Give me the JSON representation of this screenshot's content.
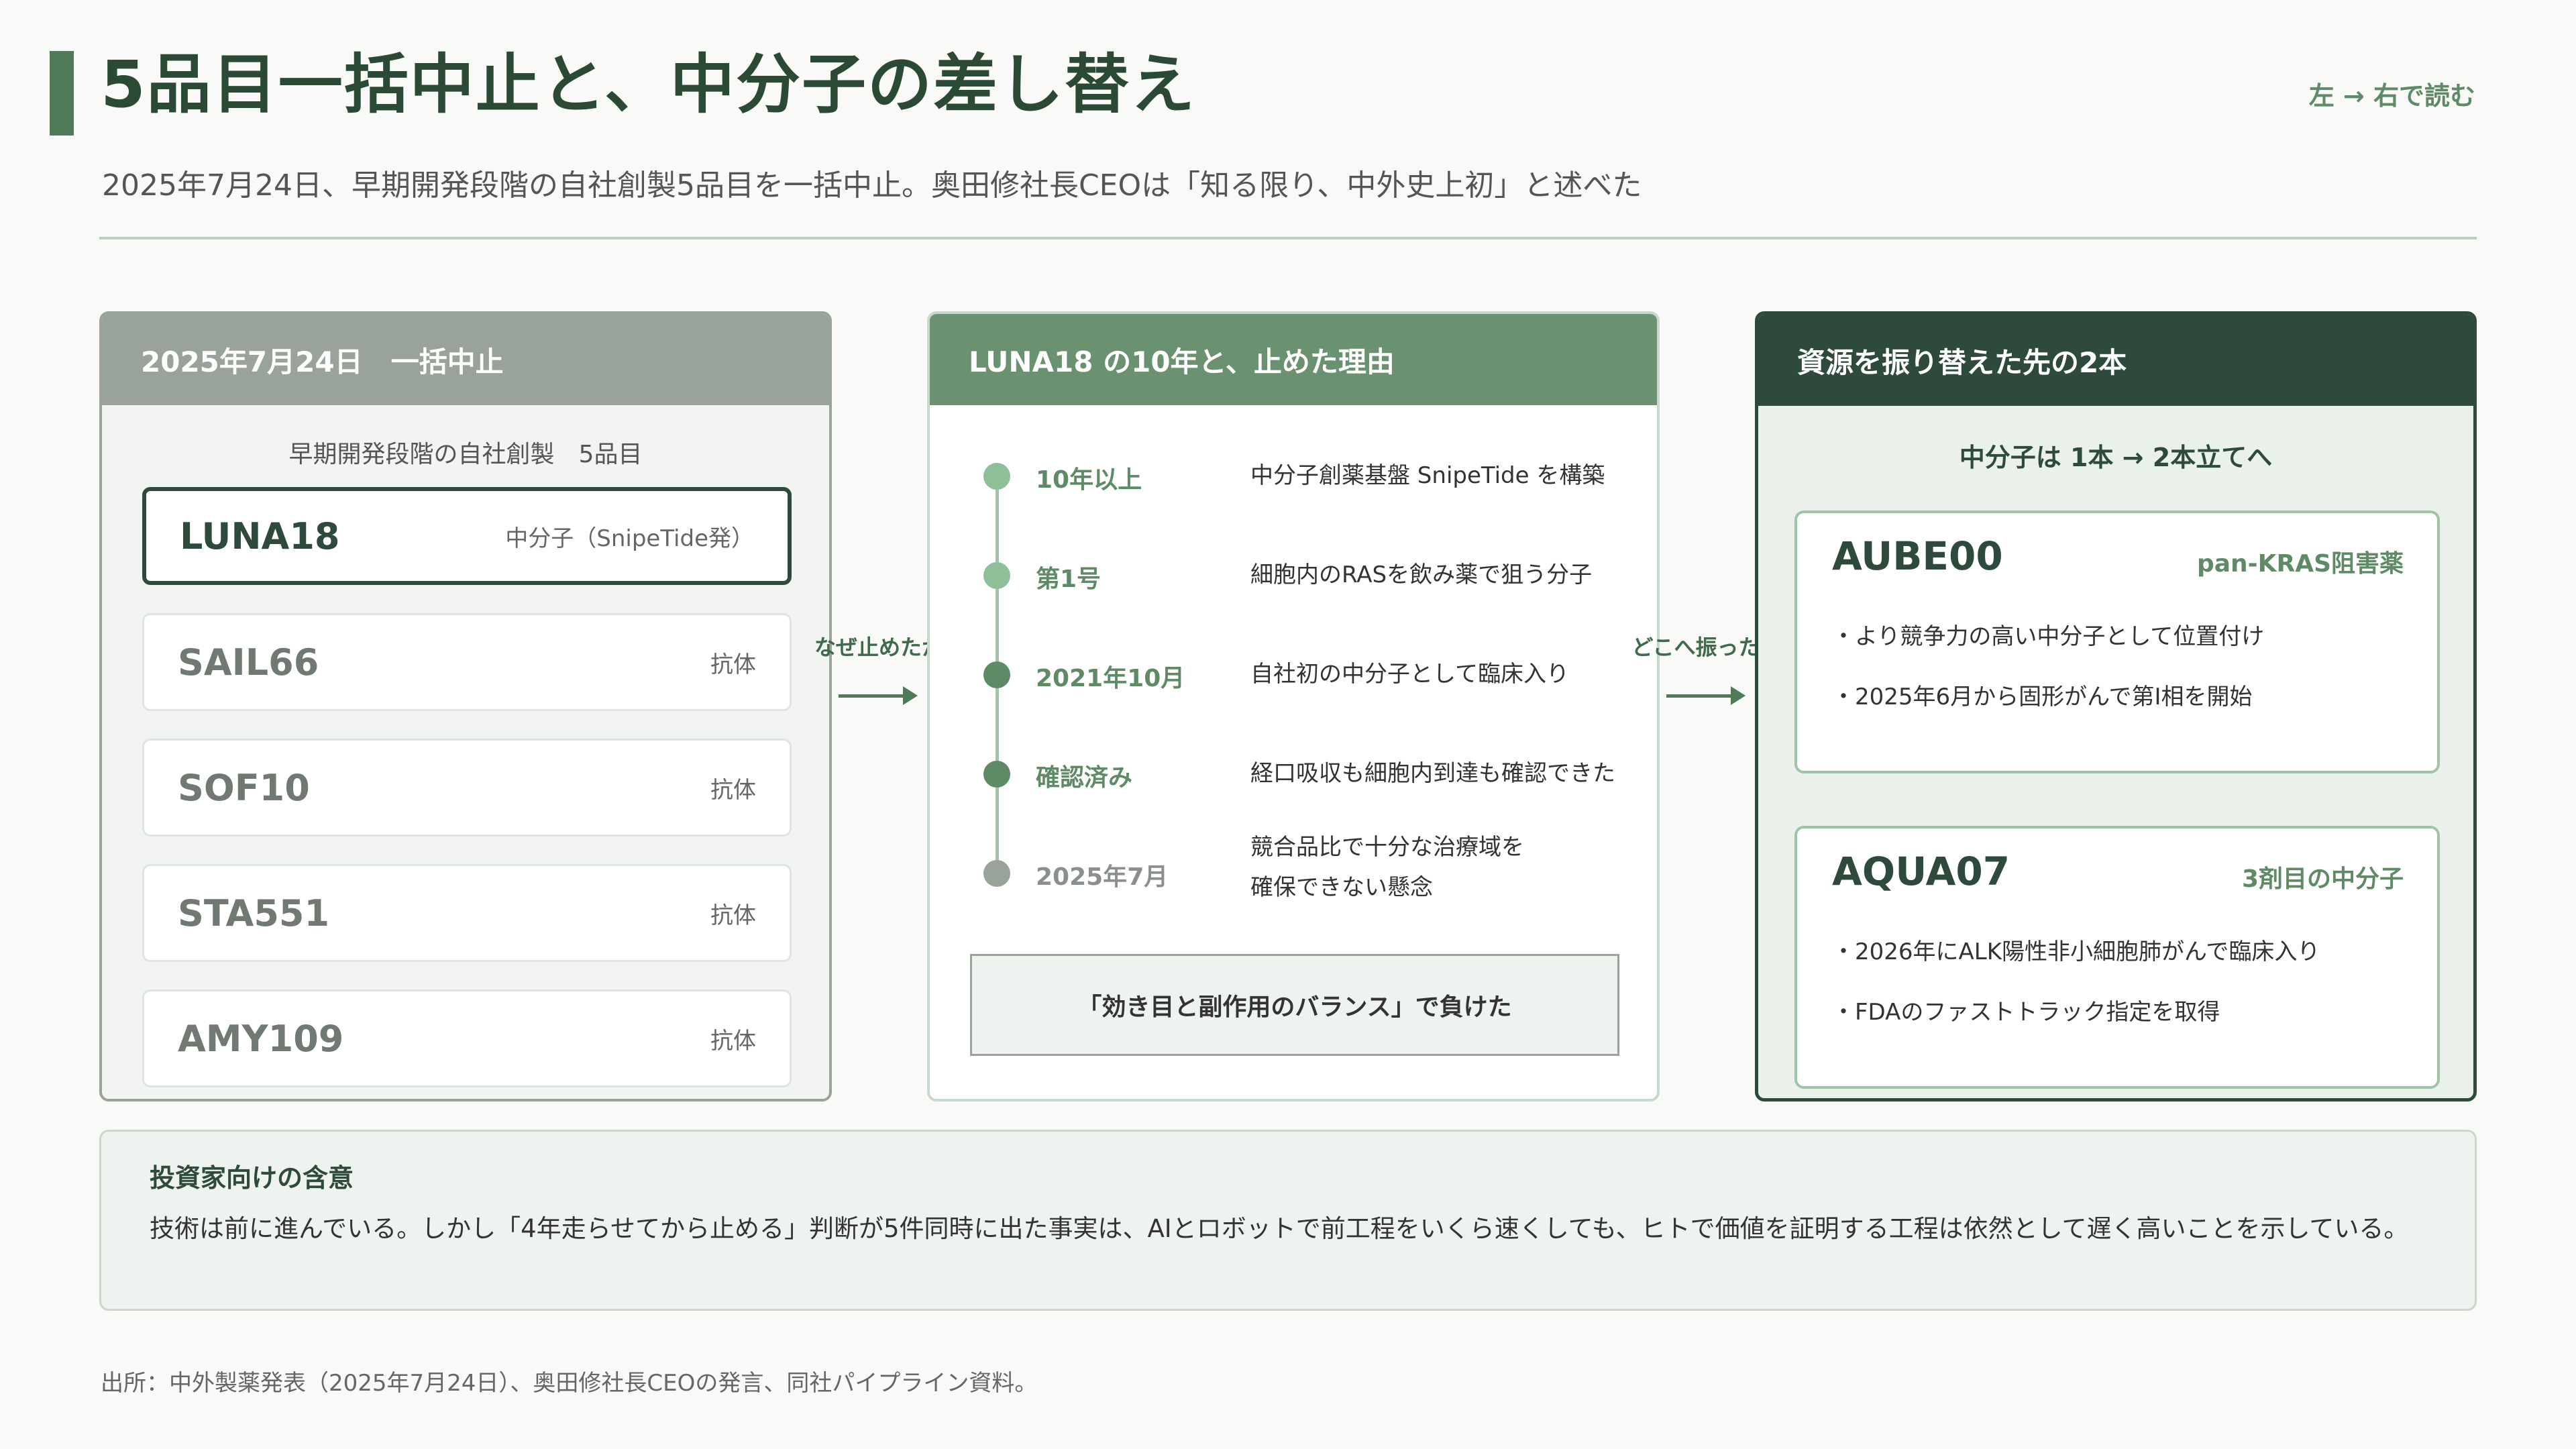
{
  "header": {
    "title": "5品目一括中止と、中分子の差し替え",
    "read_hint": "左 → 右で読む",
    "subtitle": "2025年7月24日、早期開発段階の自社創製5品目を一括中止。奥田修社長CEOは「知る限り、中外史上初」と述べた"
  },
  "panel_left": {
    "header": "2025年7月24日　一括中止",
    "subtitle": "早期開発段階の自社創製　5品目",
    "items": [
      {
        "name": "LUNA18",
        "type": "中分子（SnipeTide発）"
      },
      {
        "name": "SAIL66",
        "type": "抗体"
      },
      {
        "name": "SOF10",
        "type": "抗体"
      },
      {
        "name": "STA551",
        "type": "抗体"
      },
      {
        "name": "AMY109",
        "type": "抗体"
      }
    ]
  },
  "connector_1": {
    "label": "なぜ止めたか"
  },
  "connector_2": {
    "label": "どこへ振ったか"
  },
  "panel_middle": {
    "header": "LUNA18 の10年と、止めた理由",
    "timeline": [
      {
        "label": "10年以上",
        "text": "中分子創薬基盤 SnipeTide を構築",
        "color": "#8fbf98"
      },
      {
        "label": "第1号",
        "text": "細胞内のRASを飲み薬で狙う分子",
        "color": "#8fbf98"
      },
      {
        "label": "2021年10月",
        "text": "自社初の中分子として臨床入り",
        "color": "#5f8a66"
      },
      {
        "label": "確認済み",
        "text": "経口吸収も細胞内到達も確認できた",
        "color": "#5f8a66"
      },
      {
        "label": "2025年7月",
        "text_line1": "競合品比で十分な治療域を",
        "text_line2": "確保できない懸念",
        "color": "#9aa39a"
      }
    ],
    "quote": "「効き目と副作用のバランス」で負けた"
  },
  "panel_right": {
    "header": "資源を振り替えた先の2本",
    "subtitle": "中分子は 1本 → 2本立てへ",
    "cards": [
      {
        "name": "AUBE00",
        "tag": "pan-KRAS阻害薬",
        "bullets": [
          "・より競争力の高い中分子として位置付け",
          "・2025年6月から固形がんで第Ⅰ相を開始"
        ]
      },
      {
        "name": "AQUA07",
        "tag": "3剤目の中分子",
        "bullets": [
          "・2026年にALK陽性非小細胞肺がんで臨床入り",
          "・FDAのファストトラック指定を取得"
        ]
      }
    ]
  },
  "implication": {
    "title": "投資家向けの含意",
    "body": "技術は前に進んでいる。しかし「4年走らせてから止める」判断が5件同時に出た事実は、AIとロボットで前工程をいくら速くしても、ヒトで価値を証明する工程は依然として遅く高いことを示している。"
  },
  "source": "出所：中外製薬発表（2025年7月24日）、奥田修社長CEOの発言、同社パイプライン資料。"
}
